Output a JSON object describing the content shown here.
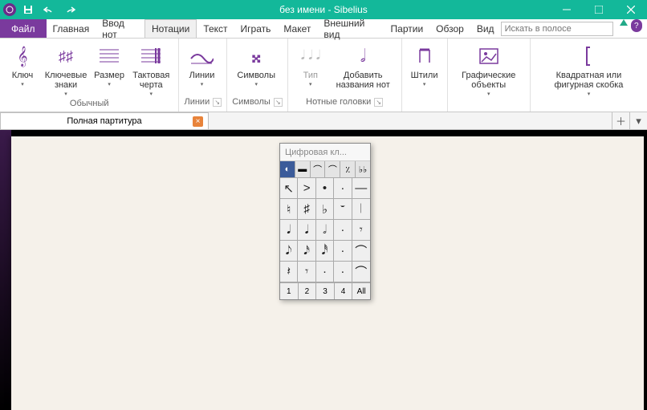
{
  "titlebar": {
    "title": "без имени - Sibelius"
  },
  "menu": {
    "file": "Файл",
    "items": [
      "Главная",
      "Ввод нот",
      "Нотации",
      "Текст",
      "Играть",
      "Макет",
      "Внешний вид",
      "Партии",
      "Обзор",
      "Вид"
    ],
    "active_index": 2,
    "search_placeholder": "Искать в полосе"
  },
  "ribbon": {
    "groups": {
      "common": {
        "label": "Обычный",
        "clef": "Ключ",
        "keysig": "Ключевые знаки",
        "timesig": "Размер",
        "barline": "Тактовая черта"
      },
      "lines": {
        "big": "Линии",
        "label": "Линии"
      },
      "symbols": {
        "big": "Символы",
        "label": "Символы"
      },
      "noteheads": {
        "type": "Тип",
        "addnames": "Добавить названия нот",
        "label": "Нотные головки"
      },
      "stems": {
        "big": "Штили"
      },
      "graphics": {
        "big": "Графические объекты"
      },
      "bracket": {
        "big": "Квадратная или фигурная скобка"
      }
    }
  },
  "doc_tab": {
    "title": "Полная партитура"
  },
  "keypad": {
    "title": "Цифровая кл...",
    "tabs": [
      "◐",
      "▬",
      "⌒",
      "⌒",
      "٪",
      "♭♭"
    ],
    "rows": [
      [
        "↖",
        ">",
        "•",
        "·",
        "—"
      ],
      [
        "♮",
        "♯",
        "♭",
        "𝄻",
        "𝄀"
      ],
      [
        "𝅘𝅥",
        "𝅘𝅥",
        "𝅗𝅥",
        "·",
        "𝄾"
      ],
      [
        "𝅘𝅥𝅮",
        "𝅘𝅥𝅯",
        "𝅘𝅥𝅰",
        "·",
        "⌒"
      ],
      [
        "𝄽",
        "𝄾",
        "·",
        "·",
        "⌒"
      ]
    ],
    "footer": [
      "1",
      "2",
      "3",
      "4",
      "All"
    ]
  }
}
